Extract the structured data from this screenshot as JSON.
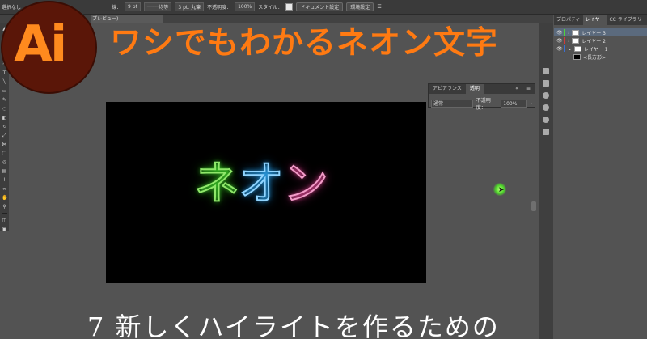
{
  "control_bar": {
    "selection": "選択なし",
    "stroke_label": "線：",
    "stroke_size": "9 pt",
    "stroke_profile": "均等",
    "brush": "3 pt. 丸筆",
    "opacity_label": "不透明度：",
    "opacity_value": "100%",
    "style_label": "スタイル：",
    "doc_settings_button": "ドキュメント設定",
    "prefs_button": "環境設定"
  },
  "document_tab": {
    "label": "プレビュー)"
  },
  "artboard": {
    "neon_text": [
      "ネ",
      "オ",
      "ン"
    ],
    "neon_colors": [
      "#8fe76a",
      "#8fd4ff",
      "#f29bc8"
    ]
  },
  "appearance_panel": {
    "tabs": [
      "アピアランス",
      "透明"
    ],
    "active_tab": "透明",
    "blend_mode": "通常",
    "opacity_label": "不透明度：",
    "opacity_value": "100%"
  },
  "layers_panel": {
    "tabs": [
      "プロパティ",
      "レイヤー",
      "CC ライブラリ"
    ],
    "active_tab": "レイヤー",
    "layers": [
      {
        "name": "レイヤー 3",
        "color": "#4fd43a",
        "selected": true
      },
      {
        "name": "レイヤー 2",
        "color": "#d23b3b",
        "selected": false
      },
      {
        "name": "レイヤー 1",
        "color": "#3b6fd2",
        "selected": false
      },
      {
        "name": "<長方形>",
        "color": "#3b6fd2",
        "selected": false
      }
    ]
  },
  "overlay": {
    "logo": "Ai",
    "title": "ワシでもわかるネオン文字",
    "subtitle": "7 新しくハイライトを作るための"
  }
}
